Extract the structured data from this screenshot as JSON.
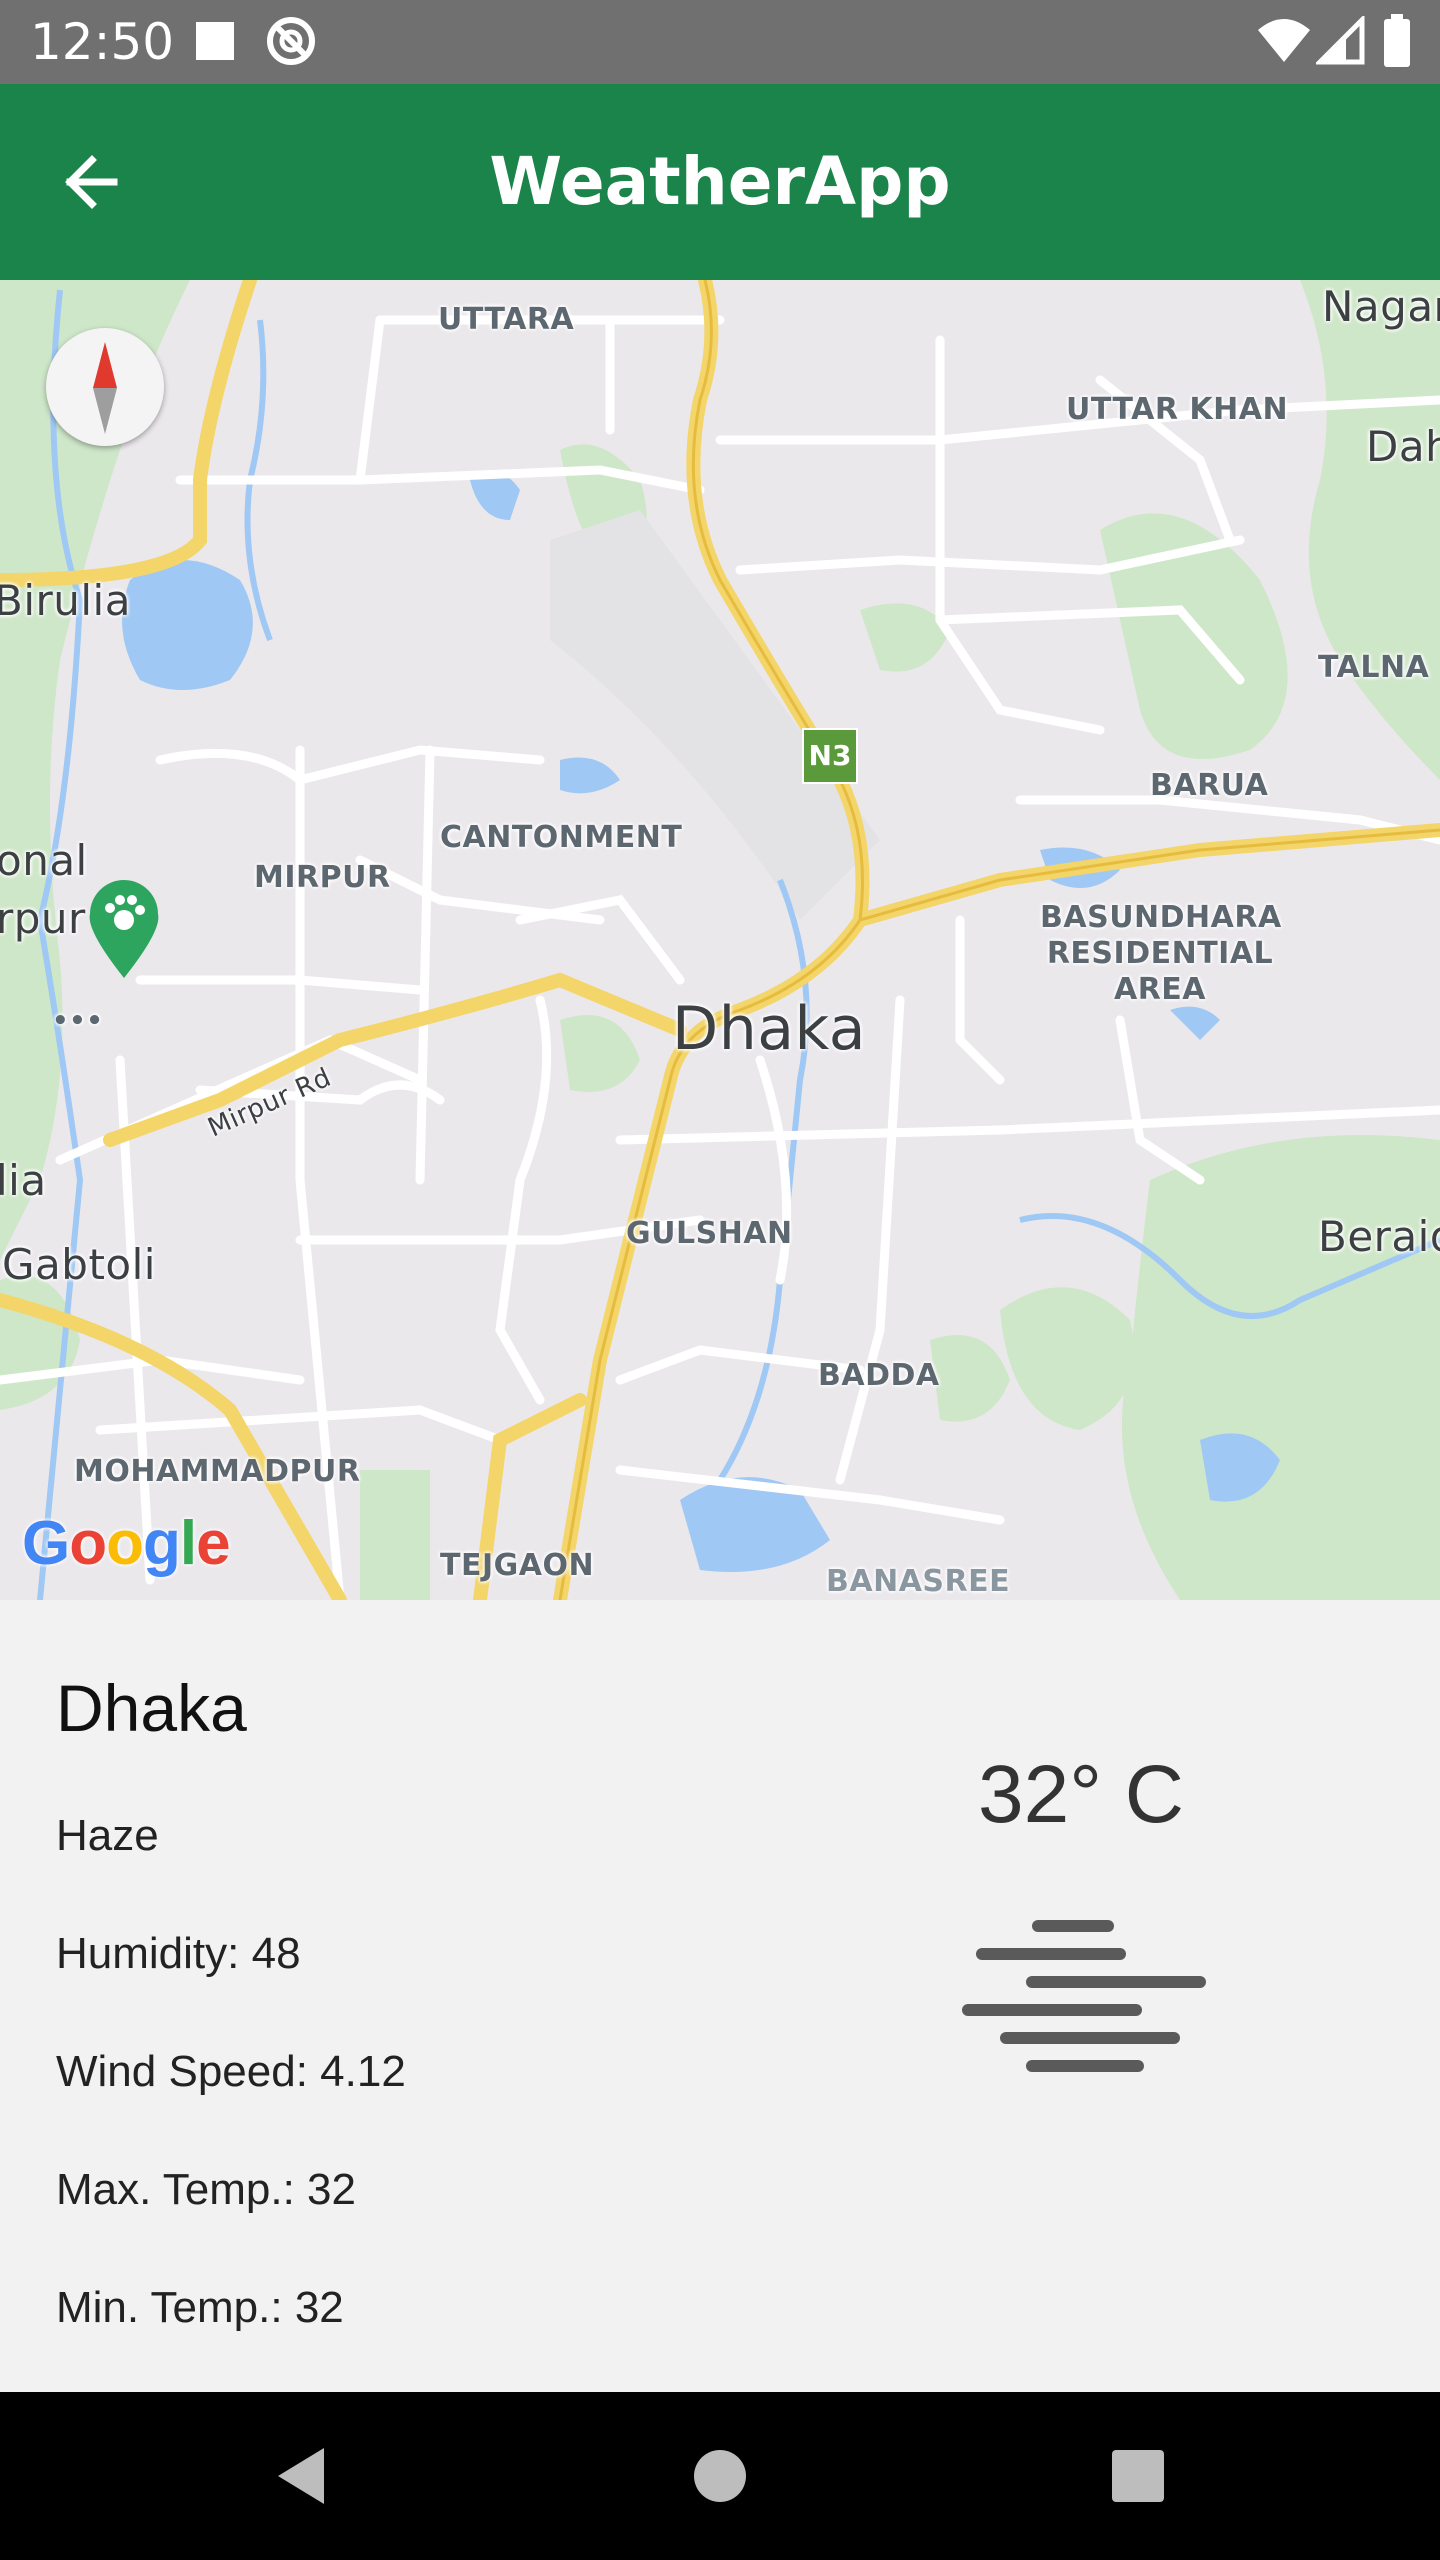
{
  "status_bar": {
    "time": "12:50",
    "icons": [
      "sd-card-icon",
      "sync-icon",
      "wifi-icon",
      "signal-icon",
      "battery-icon"
    ]
  },
  "app_bar": {
    "title": "WeatherApp",
    "back_icon": "arrow-back-icon",
    "color": "#1a844a"
  },
  "map": {
    "city_label": "Dhaka",
    "route_shield": "N3",
    "road_label": "Mirpur Rd",
    "attribution": "Google",
    "areas": [
      "UTTARA",
      "UTTAR KHAN",
      "Nagar",
      "Dah",
      "Birulia",
      "TALNA",
      "BARUA",
      "CANTONMENT",
      "MIRPUR",
      "onal",
      "rpur",
      "BASUNDHARA",
      "RESIDENTIAL",
      "AREA",
      "lia",
      "Gabtoli",
      "GULSHAN",
      "Beraid",
      "BADDA",
      "MOHAMMADPUR",
      "TEJGAON",
      "BANASREE"
    ]
  },
  "weather": {
    "city": "Dhaka",
    "condition": "Haze",
    "humidity": "Humidity: 48",
    "wind_speed": "Wind Speed: 4.12",
    "max_temp": "Max. Temp.: 32",
    "min_temp": "Min. Temp.: 32",
    "temperature": "32° C",
    "icon": "haze-icon"
  },
  "nav_bar": {
    "buttons": [
      "back-triangle-icon",
      "home-circle-icon",
      "recents-square-icon"
    ]
  }
}
